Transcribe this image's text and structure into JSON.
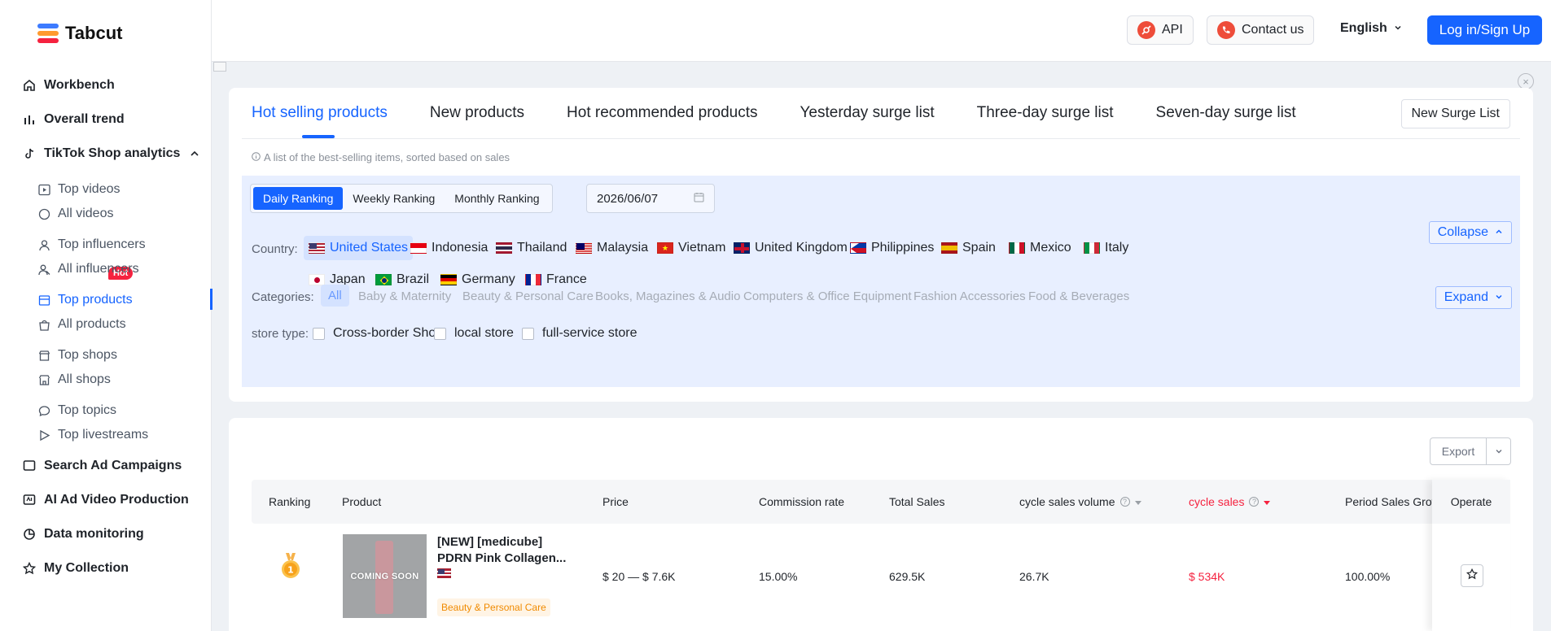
{
  "brand": {
    "name": "Tabcut",
    "colors": [
      "#3d7bff",
      "#ff9a2e",
      "#f5223f"
    ]
  },
  "sidebar": {
    "items": [
      {
        "label": "Workbench",
        "icon": "home-icon"
      },
      {
        "label": "Overall trend",
        "icon": "bar-chart-icon"
      },
      {
        "label": "TikTok Shop analytics",
        "icon": "tiktok-icon"
      },
      {
        "label": "Top videos",
        "icon": "video-play-icon",
        "badge": "Hot"
      },
      {
        "label": "All videos",
        "icon": "circle-icon"
      },
      {
        "label": "Top influencers",
        "icon": "user-icon"
      },
      {
        "label": "All influencers",
        "icon": "users-icon"
      },
      {
        "label": "Top products",
        "icon": "product-icon",
        "active": true
      },
      {
        "label": "All products",
        "icon": "bag-icon"
      },
      {
        "label": "Top shops",
        "icon": "shop-icon"
      },
      {
        "label": "All shops",
        "icon": "store-icon"
      },
      {
        "label": "Top topics",
        "icon": "chat-icon"
      },
      {
        "label": "Top livestreams",
        "icon": "play-icon"
      },
      {
        "label": "Search Ad Campaigns",
        "icon": "ad-icon"
      },
      {
        "label": "AI Ad Video Production",
        "icon": "ai-video-icon"
      },
      {
        "label": "Data monitoring",
        "icon": "monitor-icon"
      },
      {
        "label": "My Collection",
        "icon": "star-icon"
      }
    ]
  },
  "topbar": {
    "api_label": "API",
    "contact_label": "Contact us",
    "language": "English",
    "login_label": "Log in/Sign Up"
  },
  "tabs": [
    {
      "label": "Hot selling products",
      "active": true
    },
    {
      "label": "New products"
    },
    {
      "label": "Hot recommended products"
    },
    {
      "label": "Yesterday surge list"
    },
    {
      "label": "Three-day surge list"
    },
    {
      "label": "Seven-day surge list"
    }
  ],
  "surge_button": "New Surge List",
  "hint": "A list of the best-selling items, sorted based on sales",
  "filters": {
    "ranking": [
      "Daily Ranking",
      "Weekly Ranking",
      "Monthly Ranking"
    ],
    "active_ranking": "Daily Ranking",
    "date": "2026/06/07",
    "country_label": "Country:",
    "countries": [
      "United States",
      "Indonesia",
      "Thailand",
      "Malaysia",
      "Vietnam",
      "United Kingdom",
      "Philippines",
      "Spain",
      "Mexico",
      "Italy",
      "Japan",
      "Brazil",
      "Germany",
      "France"
    ],
    "active_country": "United States",
    "collapse_label": "Collapse",
    "categories_label": "Categories:",
    "categories": [
      "All",
      "Baby & Maternity",
      "Beauty & Personal Care",
      "Books, Magazines & Audio",
      "Computers & Office Equipment",
      "Fashion Accessories",
      "Food & Beverages"
    ],
    "expand_label": "Expand",
    "store_type_label": "store type:",
    "store_types": [
      "Cross-border Shop",
      "local store",
      "full-service store"
    ]
  },
  "table": {
    "export_label": "Export",
    "columns": [
      "Ranking",
      "Product",
      "Price",
      "Commission rate",
      "Total Sales",
      "cycle sales volume",
      "cycle sales",
      "Period Sales Grow",
      "Operate"
    ],
    "rows": [
      {
        "rank": 1,
        "thumb_text": "COMING SOON",
        "name_line1": "[NEW] [medicube]",
        "name_line2": "PDRN Pink Collagen...",
        "category": "Beauty & Personal Care",
        "price": "$ 20 — $ 7.6K",
        "commission": "15.00%",
        "total_sales": "629.5K",
        "cycle_volume": "26.7K",
        "cycle_sales": "$ 534K",
        "growth": "100.00%"
      }
    ]
  }
}
